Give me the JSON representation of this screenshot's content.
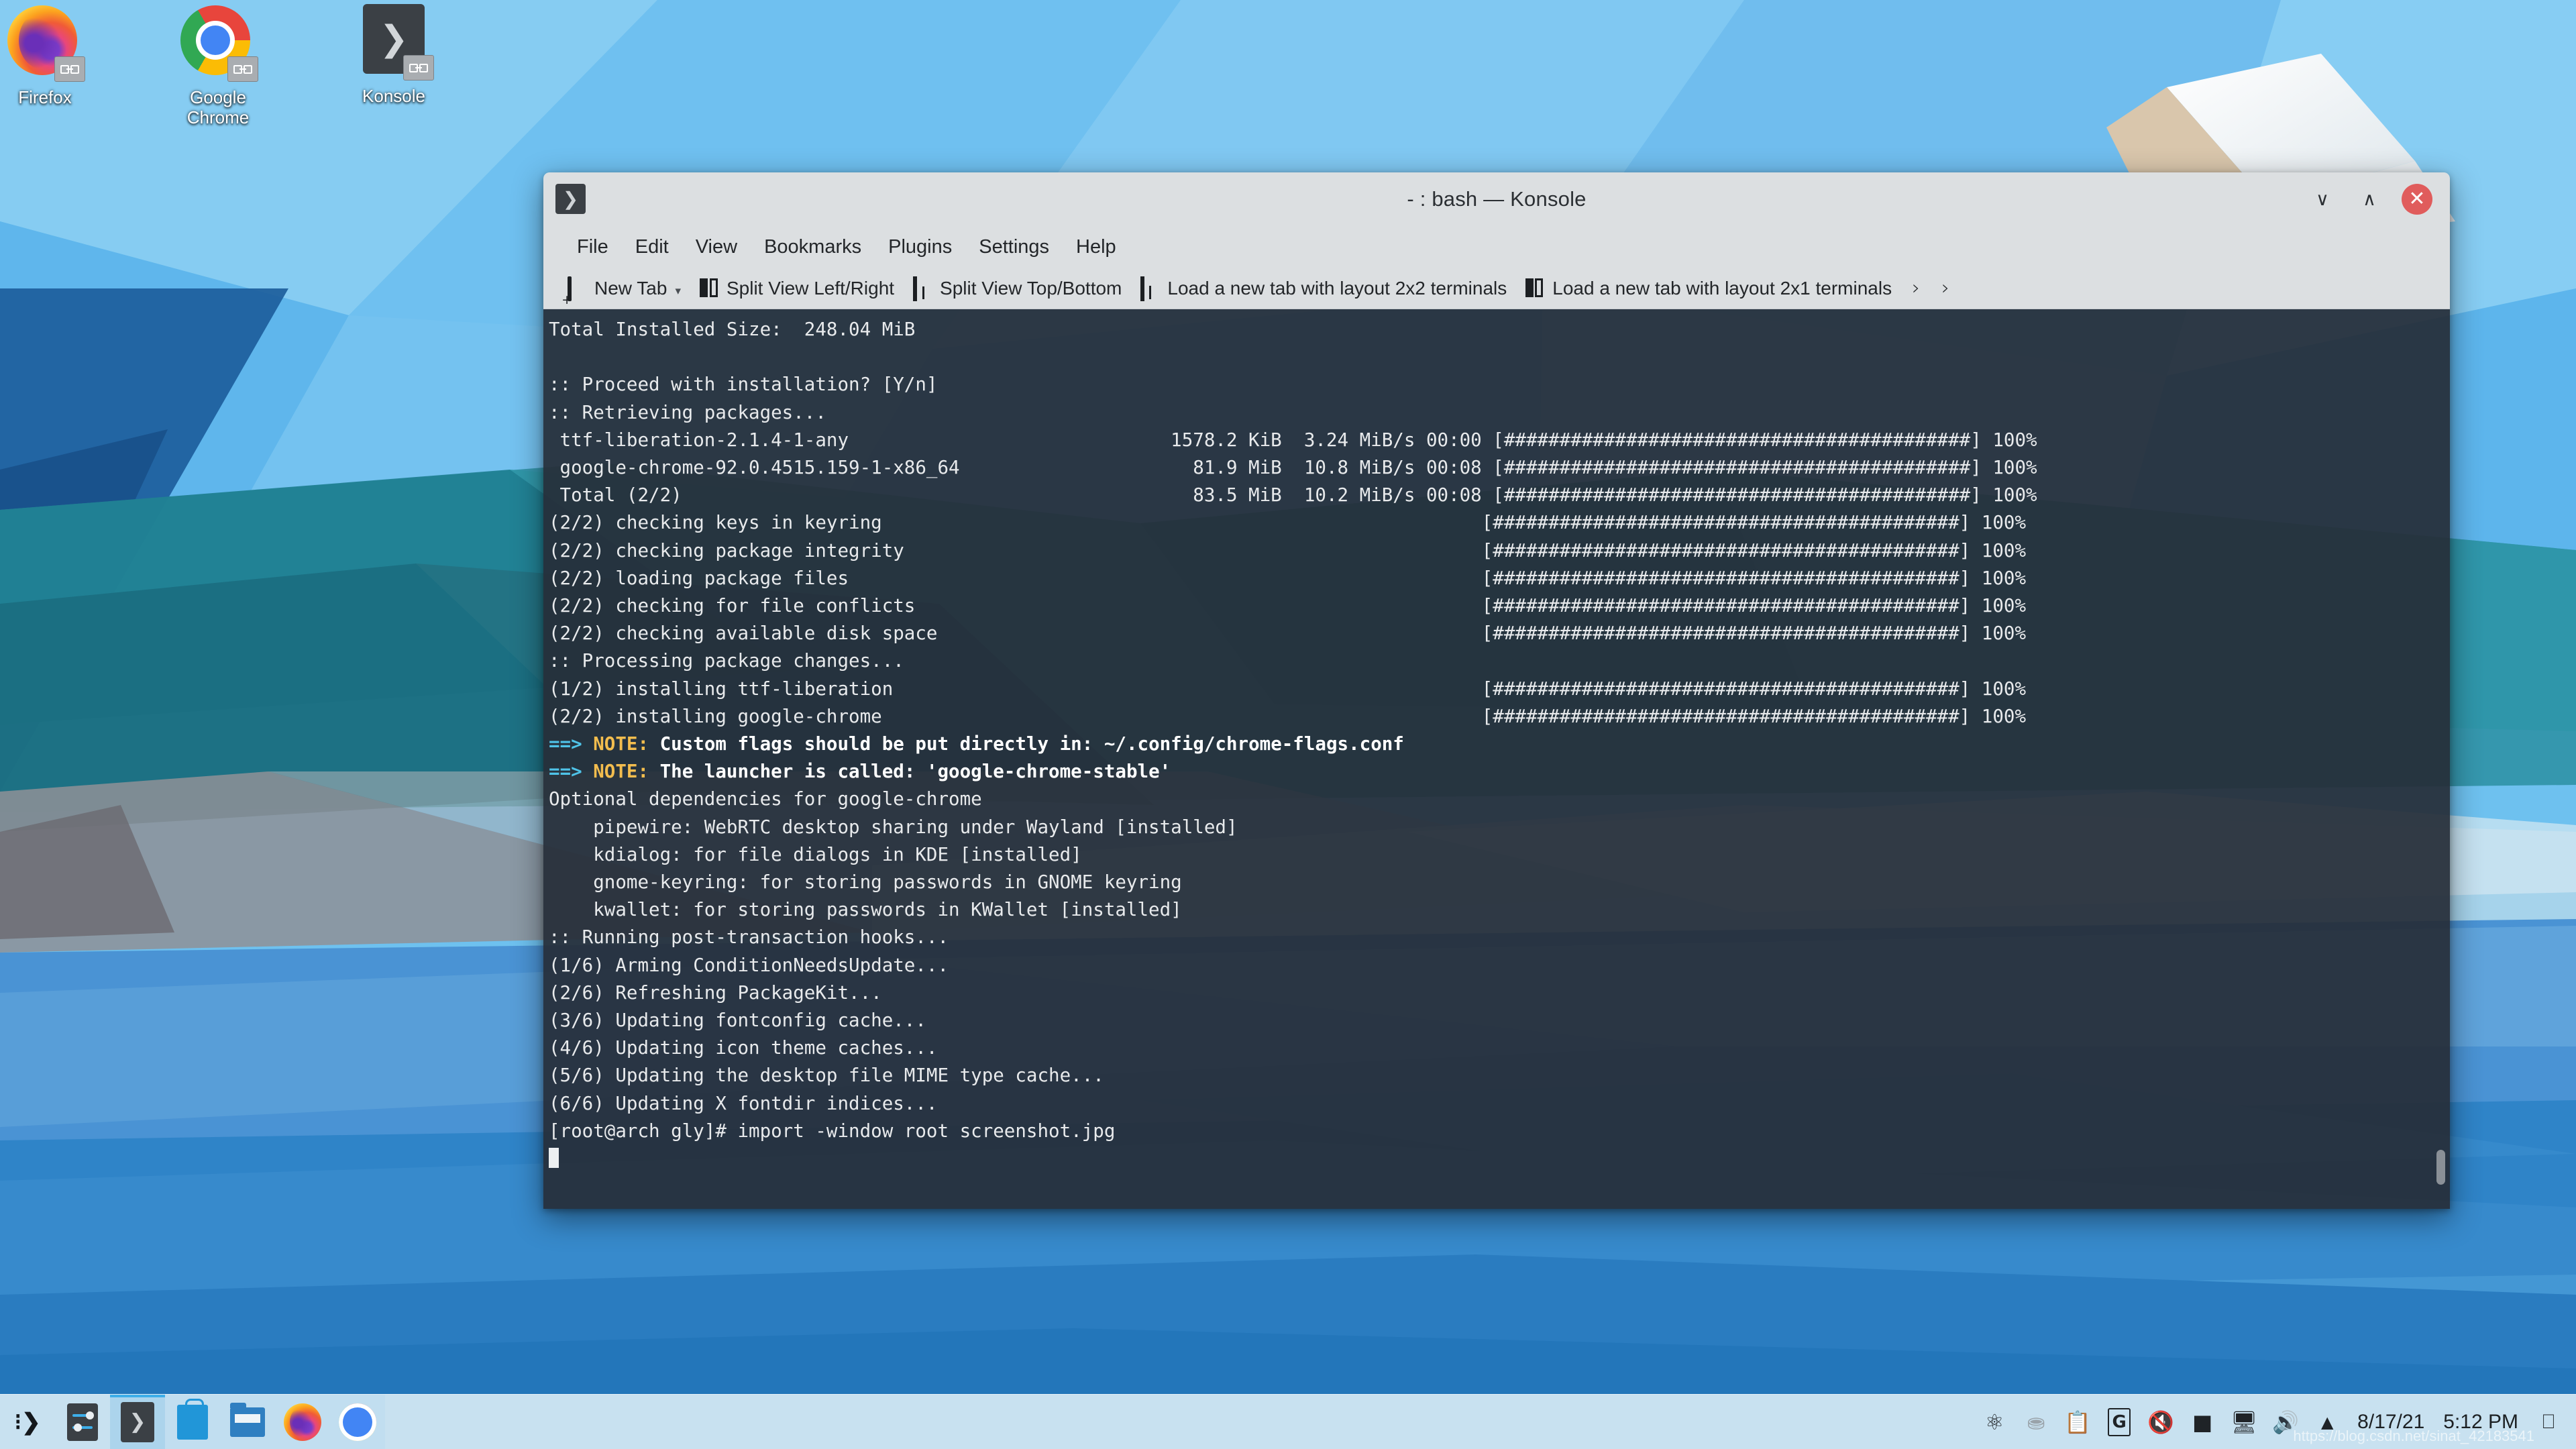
{
  "desktop": {
    "icons": [
      {
        "label": "Firefox",
        "icon": "firefox-icon"
      },
      {
        "label": "Google\nChrome",
        "label_line1": "Google",
        "label_line2": "Chrome",
        "icon": "google-chrome-icon"
      },
      {
        "label": "Konsole",
        "icon": "konsole-icon"
      }
    ]
  },
  "window": {
    "title": "- : bash — Konsole",
    "app_icon": "konsole-terminal-icon",
    "controls": {
      "minimize": "∨",
      "maximize": "∧",
      "close": "✕"
    },
    "menu": [
      "File",
      "Edit",
      "View",
      "Bookmarks",
      "Plugins",
      "Settings",
      "Help"
    ],
    "toolbar": {
      "buttons": [
        {
          "label": "New Tab",
          "icon": "new-tab-icon",
          "has_dropdown": true
        },
        {
          "label": "Split View Left/Right",
          "icon": "split-left-right-icon",
          "has_dropdown": false
        },
        {
          "label": "Split View Top/Bottom",
          "icon": "split-top-bottom-icon",
          "has_dropdown": false
        },
        {
          "label": "Load a new tab with layout 2x2 terminals",
          "icon": "layout-2x2-icon",
          "has_dropdown": false
        },
        {
          "label": "Load a new tab with layout 2x1 terminals",
          "icon": "layout-2x1-icon",
          "has_dropdown": false
        }
      ],
      "overflow_chevron_1": "›",
      "overflow_chevron_2": "›"
    }
  },
  "terminal": {
    "colors": {
      "background": "#262d38",
      "foreground": "#e8eaec",
      "cyan": "#4fc3e8",
      "yellow": "#f3bd4e",
      "bold_white": "#ffffff"
    },
    "lines": [
      {
        "type": "plain",
        "text": "Total Installed Size:  248.04 MiB"
      },
      {
        "type": "plain",
        "text": ""
      },
      {
        "type": "plain",
        "text": ":: Proceed with installation? [Y/n]"
      },
      {
        "type": "plain",
        "text": ":: Retrieving packages..."
      },
      {
        "type": "plain",
        "text": " ttf-liberation-2.1.4-1-any                             1578.2 KiB  3.24 MiB/s 00:00 [##########################################] 100%"
      },
      {
        "type": "plain",
        "text": " google-chrome-92.0.4515.159-1-x86_64                     81.9 MiB  10.8 MiB/s 00:08 [##########################################] 100%"
      },
      {
        "type": "plain",
        "text": " Total (2/2)                                              83.5 MiB  10.2 MiB/s 00:08 [##########################################] 100%"
      },
      {
        "type": "plain",
        "text": "(2/2) checking keys in keyring                                                      [##########################################] 100%"
      },
      {
        "type": "plain",
        "text": "(2/2) checking package integrity                                                    [##########################################] 100%"
      },
      {
        "type": "plain",
        "text": "(2/2) loading package files                                                         [##########################################] 100%"
      },
      {
        "type": "plain",
        "text": "(2/2) checking for file conflicts                                                   [##########################################] 100%"
      },
      {
        "type": "plain",
        "text": "(2/2) checking available disk space                                                 [##########################################] 100%"
      },
      {
        "type": "plain",
        "text": ":: Processing package changes..."
      },
      {
        "type": "plain",
        "text": "(1/2) installing ttf-liberation                                                     [##########################################] 100%"
      },
      {
        "type": "plain",
        "text": "(2/2) installing google-chrome                                                      [##########################################] 100%"
      },
      {
        "type": "note",
        "arrow": "==> ",
        "tag": "NOTE:",
        "text": " Custom flags should be put directly in: ~/.config/chrome-flags.conf"
      },
      {
        "type": "note",
        "arrow": "==> ",
        "tag": "NOTE:",
        "text": " The launcher is called: 'google-chrome-stable'"
      },
      {
        "type": "plain",
        "text": "Optional dependencies for google-chrome"
      },
      {
        "type": "plain",
        "text": "    pipewire: WebRTC desktop sharing under Wayland [installed]"
      },
      {
        "type": "plain",
        "text": "    kdialog: for file dialogs in KDE [installed]"
      },
      {
        "type": "plain",
        "text": "    gnome-keyring: for storing passwords in GNOME keyring"
      },
      {
        "type": "plain",
        "text": "    kwallet: for storing passwords in KWallet [installed]"
      },
      {
        "type": "plain",
        "text": ":: Running post-transaction hooks..."
      },
      {
        "type": "plain",
        "text": "(1/6) Arming ConditionNeedsUpdate..."
      },
      {
        "type": "plain",
        "text": "(2/6) Refreshing PackageKit..."
      },
      {
        "type": "plain",
        "text": "(3/6) Updating fontconfig cache..."
      },
      {
        "type": "plain",
        "text": "(4/6) Updating icon theme caches..."
      },
      {
        "type": "plain",
        "text": "(5/6) Updating the desktop file MIME type cache..."
      },
      {
        "type": "plain",
        "text": "(6/6) Updating X fontdir indices..."
      },
      {
        "type": "plain",
        "text": "[root@arch gly]# import -window root screenshot.jpg"
      }
    ],
    "prompt": "[root@arch gly]# ",
    "command": "import -window root screenshot.jpg"
  },
  "taskbar": {
    "launchers": [
      {
        "name": "kde-application-menu-icon"
      },
      {
        "name": "system-settings-icon"
      },
      {
        "name": "konsole-icon"
      },
      {
        "name": "discover-software-icon"
      },
      {
        "name": "dolphin-file-manager-icon"
      },
      {
        "name": "firefox-icon"
      },
      {
        "name": "google-chrome-icon"
      }
    ],
    "tray": [
      {
        "name": "kde-connect-icon",
        "glyph": "⎇"
      },
      {
        "name": "user-account-icon",
        "glyph": "⛉"
      },
      {
        "name": "clipboard-icon",
        "glyph": "ὌB"
      },
      {
        "name": "grammarly-icon",
        "glyph": "G"
      },
      {
        "name": "microphone-muted-icon",
        "glyph": "ὐ7"
      },
      {
        "name": "display-icon",
        "glyph": "■"
      },
      {
        "name": "network-icon",
        "glyph": "὚7"
      },
      {
        "name": "volume-icon",
        "glyph": "ὐA"
      },
      {
        "name": "show-hidden-icons-arrow",
        "glyph": "▲"
      }
    ],
    "clock": {
      "date": "8/17/21",
      "time": "5:12 PM"
    },
    "pager_icon": "virtual-desktop-pager-icon",
    "watermark": "https://blog.csdn.net/sinat_42183541"
  }
}
